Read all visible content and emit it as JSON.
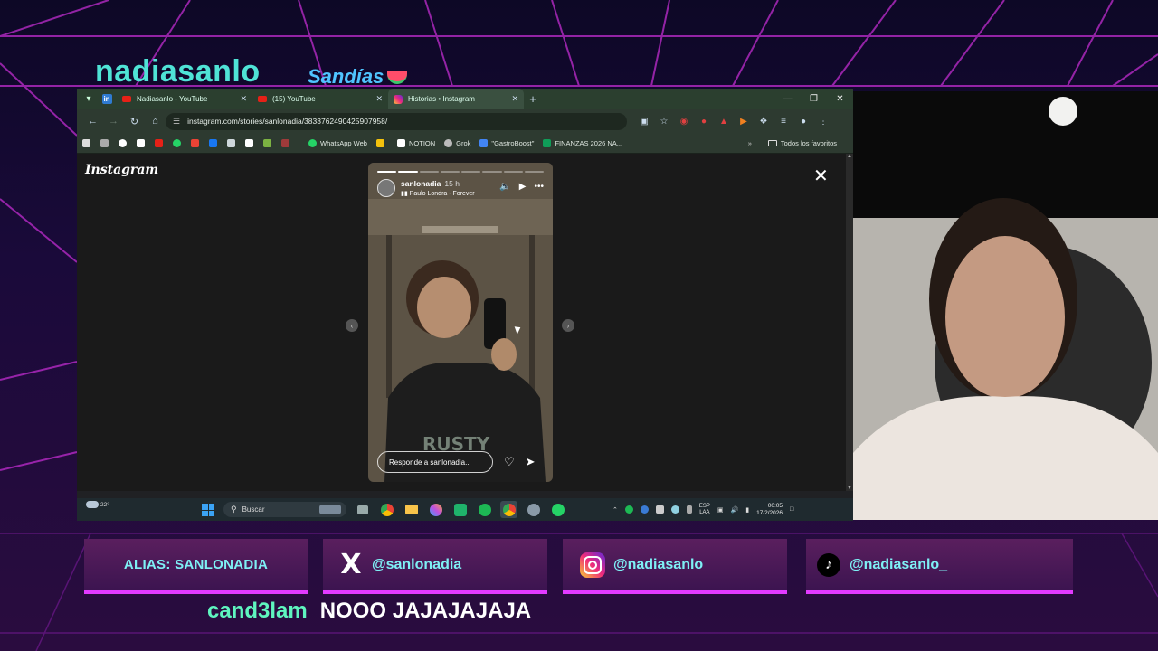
{
  "overlay": {
    "streamer_name": "nadiasanlo",
    "team_name": "Sandías",
    "alias_label": "ALIAS: SANLONADIA",
    "socials": [
      {
        "platform": "x-icon",
        "handle": "@sanlonadia"
      },
      {
        "platform": "instagram-icon",
        "handle": "@nadiasanlo"
      },
      {
        "platform": "tiktok-icon",
        "handle": "@nadiasanlo_"
      }
    ],
    "chat": {
      "user": "cand3lam",
      "message": "NOOO JAJAJAJAJA"
    },
    "colors": {
      "accent_cyan": "#4fe3d6",
      "accent_magenta": "#e23aff",
      "panel": "#5a1f5e"
    }
  },
  "browser": {
    "tabs": [
      {
        "label": "Nadiasanlo - YouTube",
        "icon": "youtube-icon",
        "active": false
      },
      {
        "label": "(15) YouTube",
        "icon": "youtube-icon",
        "active": false
      },
      {
        "label": "Historias • Instagram",
        "icon": "instagram-icon",
        "active": true
      }
    ],
    "url": "instagram.com/stories/sanlonadia/3833762490425907958/",
    "bookmarks": [
      {
        "label": "WhatsApp Web",
        "color": "#25d366"
      },
      {
        "label": "NOTION",
        "color": "#ffffff"
      },
      {
        "label": "Grok",
        "color": "#cccccc"
      },
      {
        "label": "\"GastroBoost\"",
        "color": "#4285f4"
      },
      {
        "label": "FINANZAS 2026 NA...",
        "color": "#0f9d58"
      }
    ],
    "bookmarks_folder": "Todos los favoritos"
  },
  "instagram": {
    "logo": "Instagram",
    "story": {
      "username": "sanlonadia",
      "time": "15 h",
      "song": "Paulo Londra - Forever",
      "reply_placeholder": "Responde a sanlonadia...",
      "segments_total": 8,
      "segments_done": 2
    }
  },
  "taskbar": {
    "temperature": "22°",
    "search_label": "Buscar",
    "lang_line1": "ESP",
    "lang_line2": "LAA",
    "time": "00:05",
    "date": "17/2/2026"
  }
}
